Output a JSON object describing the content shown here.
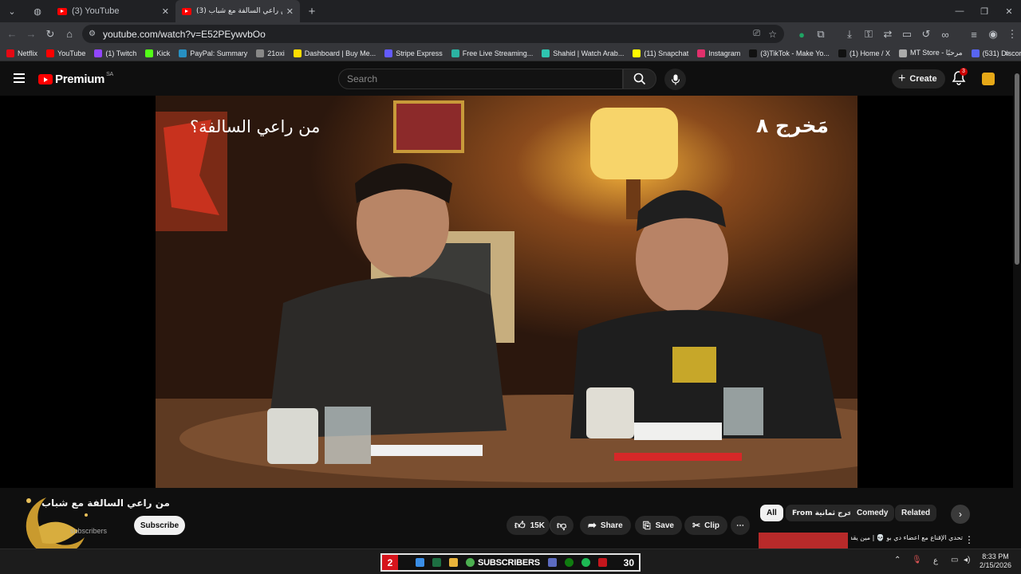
{
  "browser": {
    "tabs": [
      {
        "label": "(3) YouTube"
      },
      {
        "label": "(3) من راعي السالفة مع شباب"
      }
    ],
    "url": "youtube.com/watch?v=E52PEywvbOo",
    "bookmarks": [
      {
        "label": "Netflix",
        "color": "#e50914"
      },
      {
        "label": "YouTube",
        "color": "#ff0000"
      },
      {
        "label": "(1) Twitch",
        "color": "#9146ff"
      },
      {
        "label": "Kick",
        "color": "#53fc18"
      },
      {
        "label": "PayPal: Summary",
        "color": "#2790c3"
      },
      {
        "label": "21oxi",
        "color": "#888888"
      },
      {
        "label": "Dashboard | Buy Me...",
        "color": "#ffdd00"
      },
      {
        "label": "Stripe Express",
        "color": "#635bff"
      },
      {
        "label": "Free Live Streaming...",
        "color": "#2bb3a3"
      },
      {
        "label": "Shahid | Watch Arab...",
        "color": "#2fc5b0"
      },
      {
        "label": "(11) Snapchat",
        "color": "#fffc00"
      },
      {
        "label": "Instagram",
        "color": "#e1306c"
      },
      {
        "label": "(3)TikTok - Make Yo...",
        "color": "#111111"
      },
      {
        "label": "(1) Home / X",
        "color": "#111111"
      },
      {
        "label": "MT Store - مرحبًا",
        "color": "#aaaaaa"
      },
      {
        "label": "(531) Discord | Frien...",
        "color": "#5865f2"
      }
    ]
  },
  "youtube": {
    "logo": "Premium",
    "region": "SA",
    "search_placeholder": "Search",
    "create_label": "Create",
    "notifications": "3"
  },
  "video": {
    "overlay_title": "من راعي السالفة؟",
    "overlay_logo": "مَخرج ٨",
    "title": "من راعي السالفة مع شباب",
    "subscribers": "subscribers",
    "subscribe_label": "Subscribe",
    "likes": "15K",
    "share_label": "Share",
    "save_label": "Save",
    "clip_label": "Clip"
  },
  "chips": {
    "all": "All",
    "from": "From مخرج ثمانية",
    "comedy": "Comedy",
    "related": "Related"
  },
  "related_video": {
    "title": "تحدي الإقناع مع اعضاء دي بو 💀 | مين يقدر"
  },
  "taskbar": {
    "stream_number": "2",
    "subscribers_label": "SUBSCRIBERS",
    "subscribers_count": "30",
    "time": "8:33 PM",
    "date": "2/15/2026",
    "lang": "ع"
  },
  "colors": {
    "brand_red": "#ff0000",
    "bg": "#0f0f0f"
  }
}
